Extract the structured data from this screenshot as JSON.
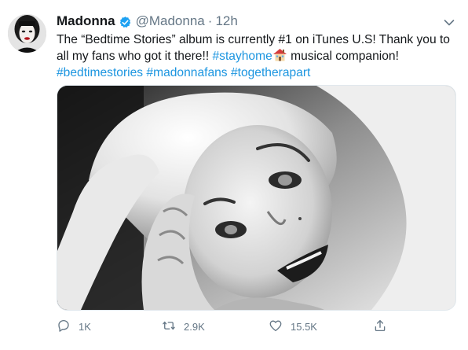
{
  "tweet": {
    "author": {
      "display_name": "Madonna",
      "handle": "@Madonna",
      "verified": true,
      "avatar": "madonna-avatar"
    },
    "separator": "·",
    "timestamp": "12h",
    "text_parts": {
      "t1": "The “Bedtime Stories” album is currently #1 on iTunes U.S! Thank you to all my fans who got it there!! ",
      "h1": "#stayhome",
      "emoji": "house-emoji",
      "t2": " musical companion! ",
      "h2": "#bedtimestories",
      "h3": "#madonnafans",
      "h4": "#togetherapart"
    },
    "media": {
      "description_icon": "black-and-white-portrait-photo"
    },
    "actions": {
      "reply_count": "1K",
      "retweet_count": "2.9K",
      "like_count": "15.5K"
    }
  },
  "colors": {
    "link": "#1b95e0",
    "verified": "#1da1f2",
    "secondary_text": "#657786",
    "primary_text": "#14171a"
  },
  "icons": [
    "verified-badge-icon",
    "chevron-down-icon",
    "reply-icon",
    "retweet-icon",
    "like-icon",
    "share-icon"
  ]
}
